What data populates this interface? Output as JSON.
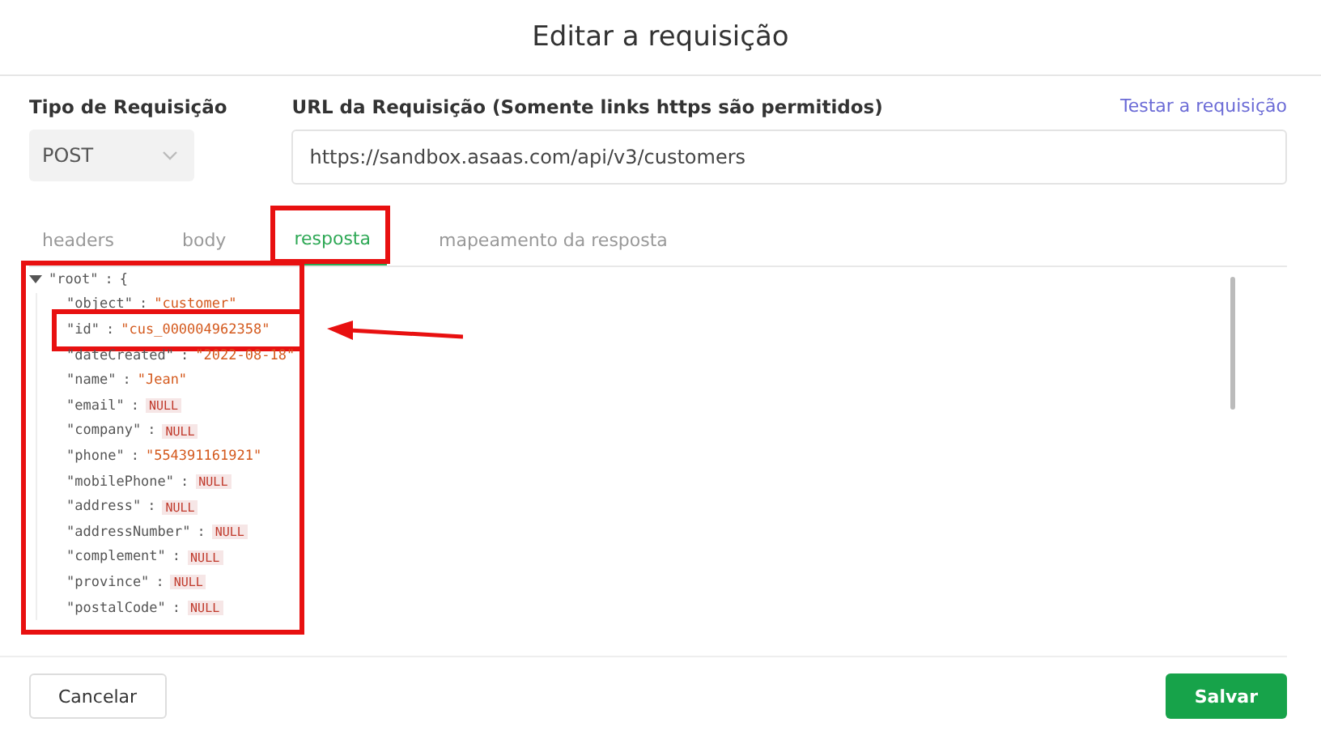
{
  "dialog": {
    "title": "Editar a requisição"
  },
  "request_type": {
    "label": "Tipo de Requisição",
    "value": "POST"
  },
  "url": {
    "label": "URL da Requisição (Somente links https são permitidos)",
    "value": "https://sandbox.asaas.com/api/v3/customers",
    "test_link": "Testar a requisição"
  },
  "tabs": [
    {
      "label": "headers",
      "selected": false
    },
    {
      "label": "body",
      "selected": false
    },
    {
      "label": "resposta",
      "selected": true
    },
    {
      "label": "mapeamento da resposta",
      "selected": false
    }
  ],
  "tree": {
    "key": "\"root\"",
    "colon": ":",
    "brace": "{",
    "expanded": true,
    "children": [
      {
        "key": "\"object\"",
        "colon": ":",
        "kind": "string",
        "value": "\"customer\""
      },
      {
        "key": "\"id\"",
        "colon": ":",
        "kind": "string",
        "value": "\"cus_000004962358\""
      },
      {
        "key": "\"dateCreated\"",
        "colon": ":",
        "kind": "string",
        "value": "\"2022-08-18\""
      },
      {
        "key": "\"name\"",
        "colon": ":",
        "kind": "string",
        "value": "\"Jean\""
      },
      {
        "key": "\"email\"",
        "colon": ":",
        "kind": "null",
        "value": "NULL"
      },
      {
        "key": "\"company\"",
        "colon": ":",
        "kind": "null",
        "value": "NULL"
      },
      {
        "key": "\"phone\"",
        "colon": ":",
        "kind": "string",
        "value": "\"554391161921\""
      },
      {
        "key": "\"mobilePhone\"",
        "colon": ":",
        "kind": "null",
        "value": "NULL"
      },
      {
        "key": "\"address\"",
        "colon": ":",
        "kind": "null",
        "value": "NULL"
      },
      {
        "key": "\"addressNumber\"",
        "colon": ":",
        "kind": "null",
        "value": "NULL"
      },
      {
        "key": "\"complement\"",
        "colon": ":",
        "kind": "null",
        "value": "NULL"
      },
      {
        "key": "\"province\"",
        "colon": ":",
        "kind": "null",
        "value": "NULL"
      },
      {
        "key": "\"postalCode\"",
        "colon": ":",
        "kind": "null",
        "value": "NULL"
      }
    ]
  },
  "buttons": {
    "cancel": "Cancelar",
    "save": "Salvar"
  }
}
